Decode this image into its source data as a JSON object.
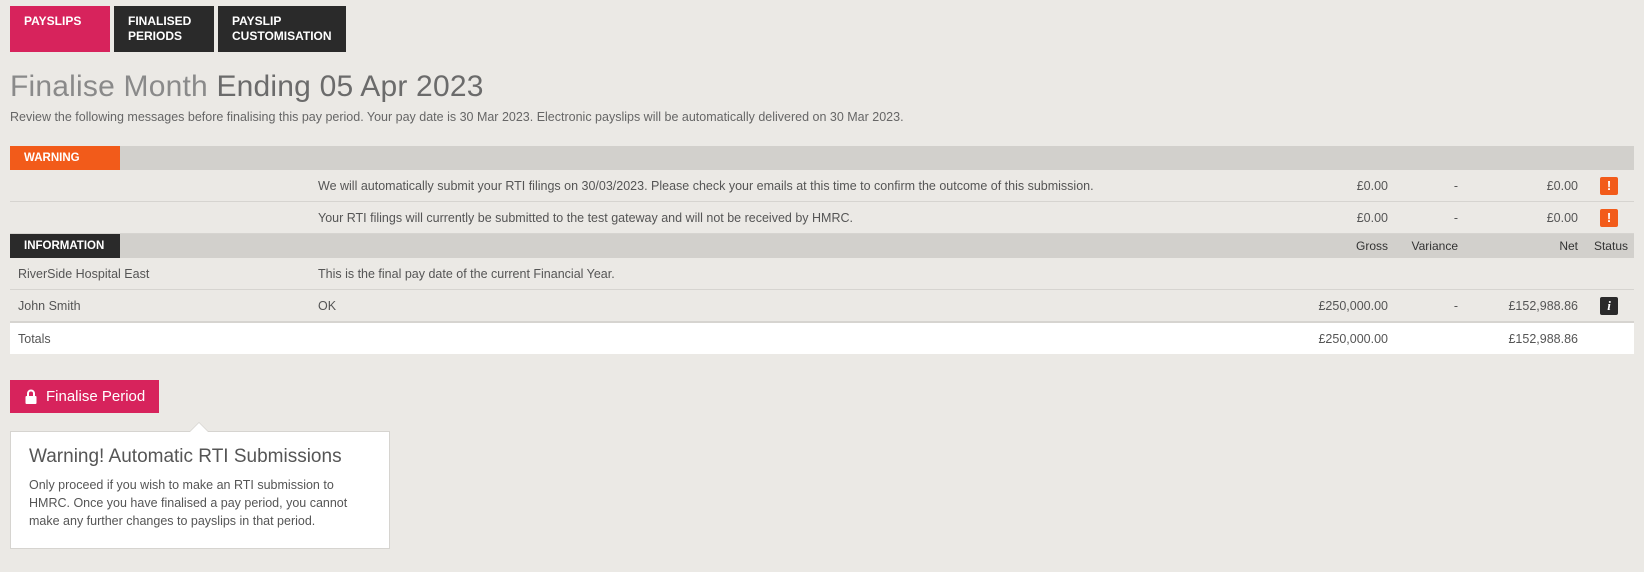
{
  "tabs": {
    "payslips": "PAYSLIPS",
    "finalised_line1": "FINALISED",
    "finalised_line2": "PERIODS",
    "customisation_line1": "PAYSLIP",
    "customisation_line2": "CUSTOMISATION"
  },
  "heading": {
    "prefix": "Finalise Month ",
    "main": "Ending 05 Apr 2023"
  },
  "subtext": "Review the following messages before finalising this pay period. Your pay date is 30 Mar 2023. Electronic payslips will be automatically delivered on 30 Mar 2023.",
  "section_labels": {
    "warning": "WARNING",
    "information": "INFORMATION"
  },
  "col_headers": {
    "gross": "Gross",
    "variance": "Variance",
    "net": "Net",
    "status": "Status"
  },
  "warnings": [
    {
      "entity": "",
      "message": "We will automatically submit your RTI filings on 30/03/2023. Please check your emails at this time to confirm the outcome of this submission.",
      "gross": "£0.00",
      "variance": "-",
      "net": "£0.00",
      "status_glyph": "!"
    },
    {
      "entity": "",
      "message": "Your RTI filings will currently be submitted to the test gateway and will not be received by HMRC.",
      "gross": "£0.00",
      "variance": "-",
      "net": "£0.00",
      "status_glyph": "!"
    }
  ],
  "info_rows": [
    {
      "entity": "RiverSide Hospital East",
      "message": "This is the final pay date of the current Financial Year.",
      "gross": "",
      "variance": "",
      "net": "",
      "status_glyph": ""
    },
    {
      "entity": "John Smith",
      "message": "OK",
      "gross": "£250,000.00",
      "variance": "-",
      "net": "£152,988.86",
      "status_glyph": "i"
    }
  ],
  "totals": {
    "label": "Totals",
    "gross": "£250,000.00",
    "net": "£152,988.86"
  },
  "finalise": {
    "button_label": "Finalise Period",
    "popover_heading": "Warning! Automatic RTI Submissions",
    "popover_body": "Only proceed if you wish to make an RTI submission to HMRC. Once you have finalised a pay period, you cannot make any further changes to payslips in that period."
  }
}
